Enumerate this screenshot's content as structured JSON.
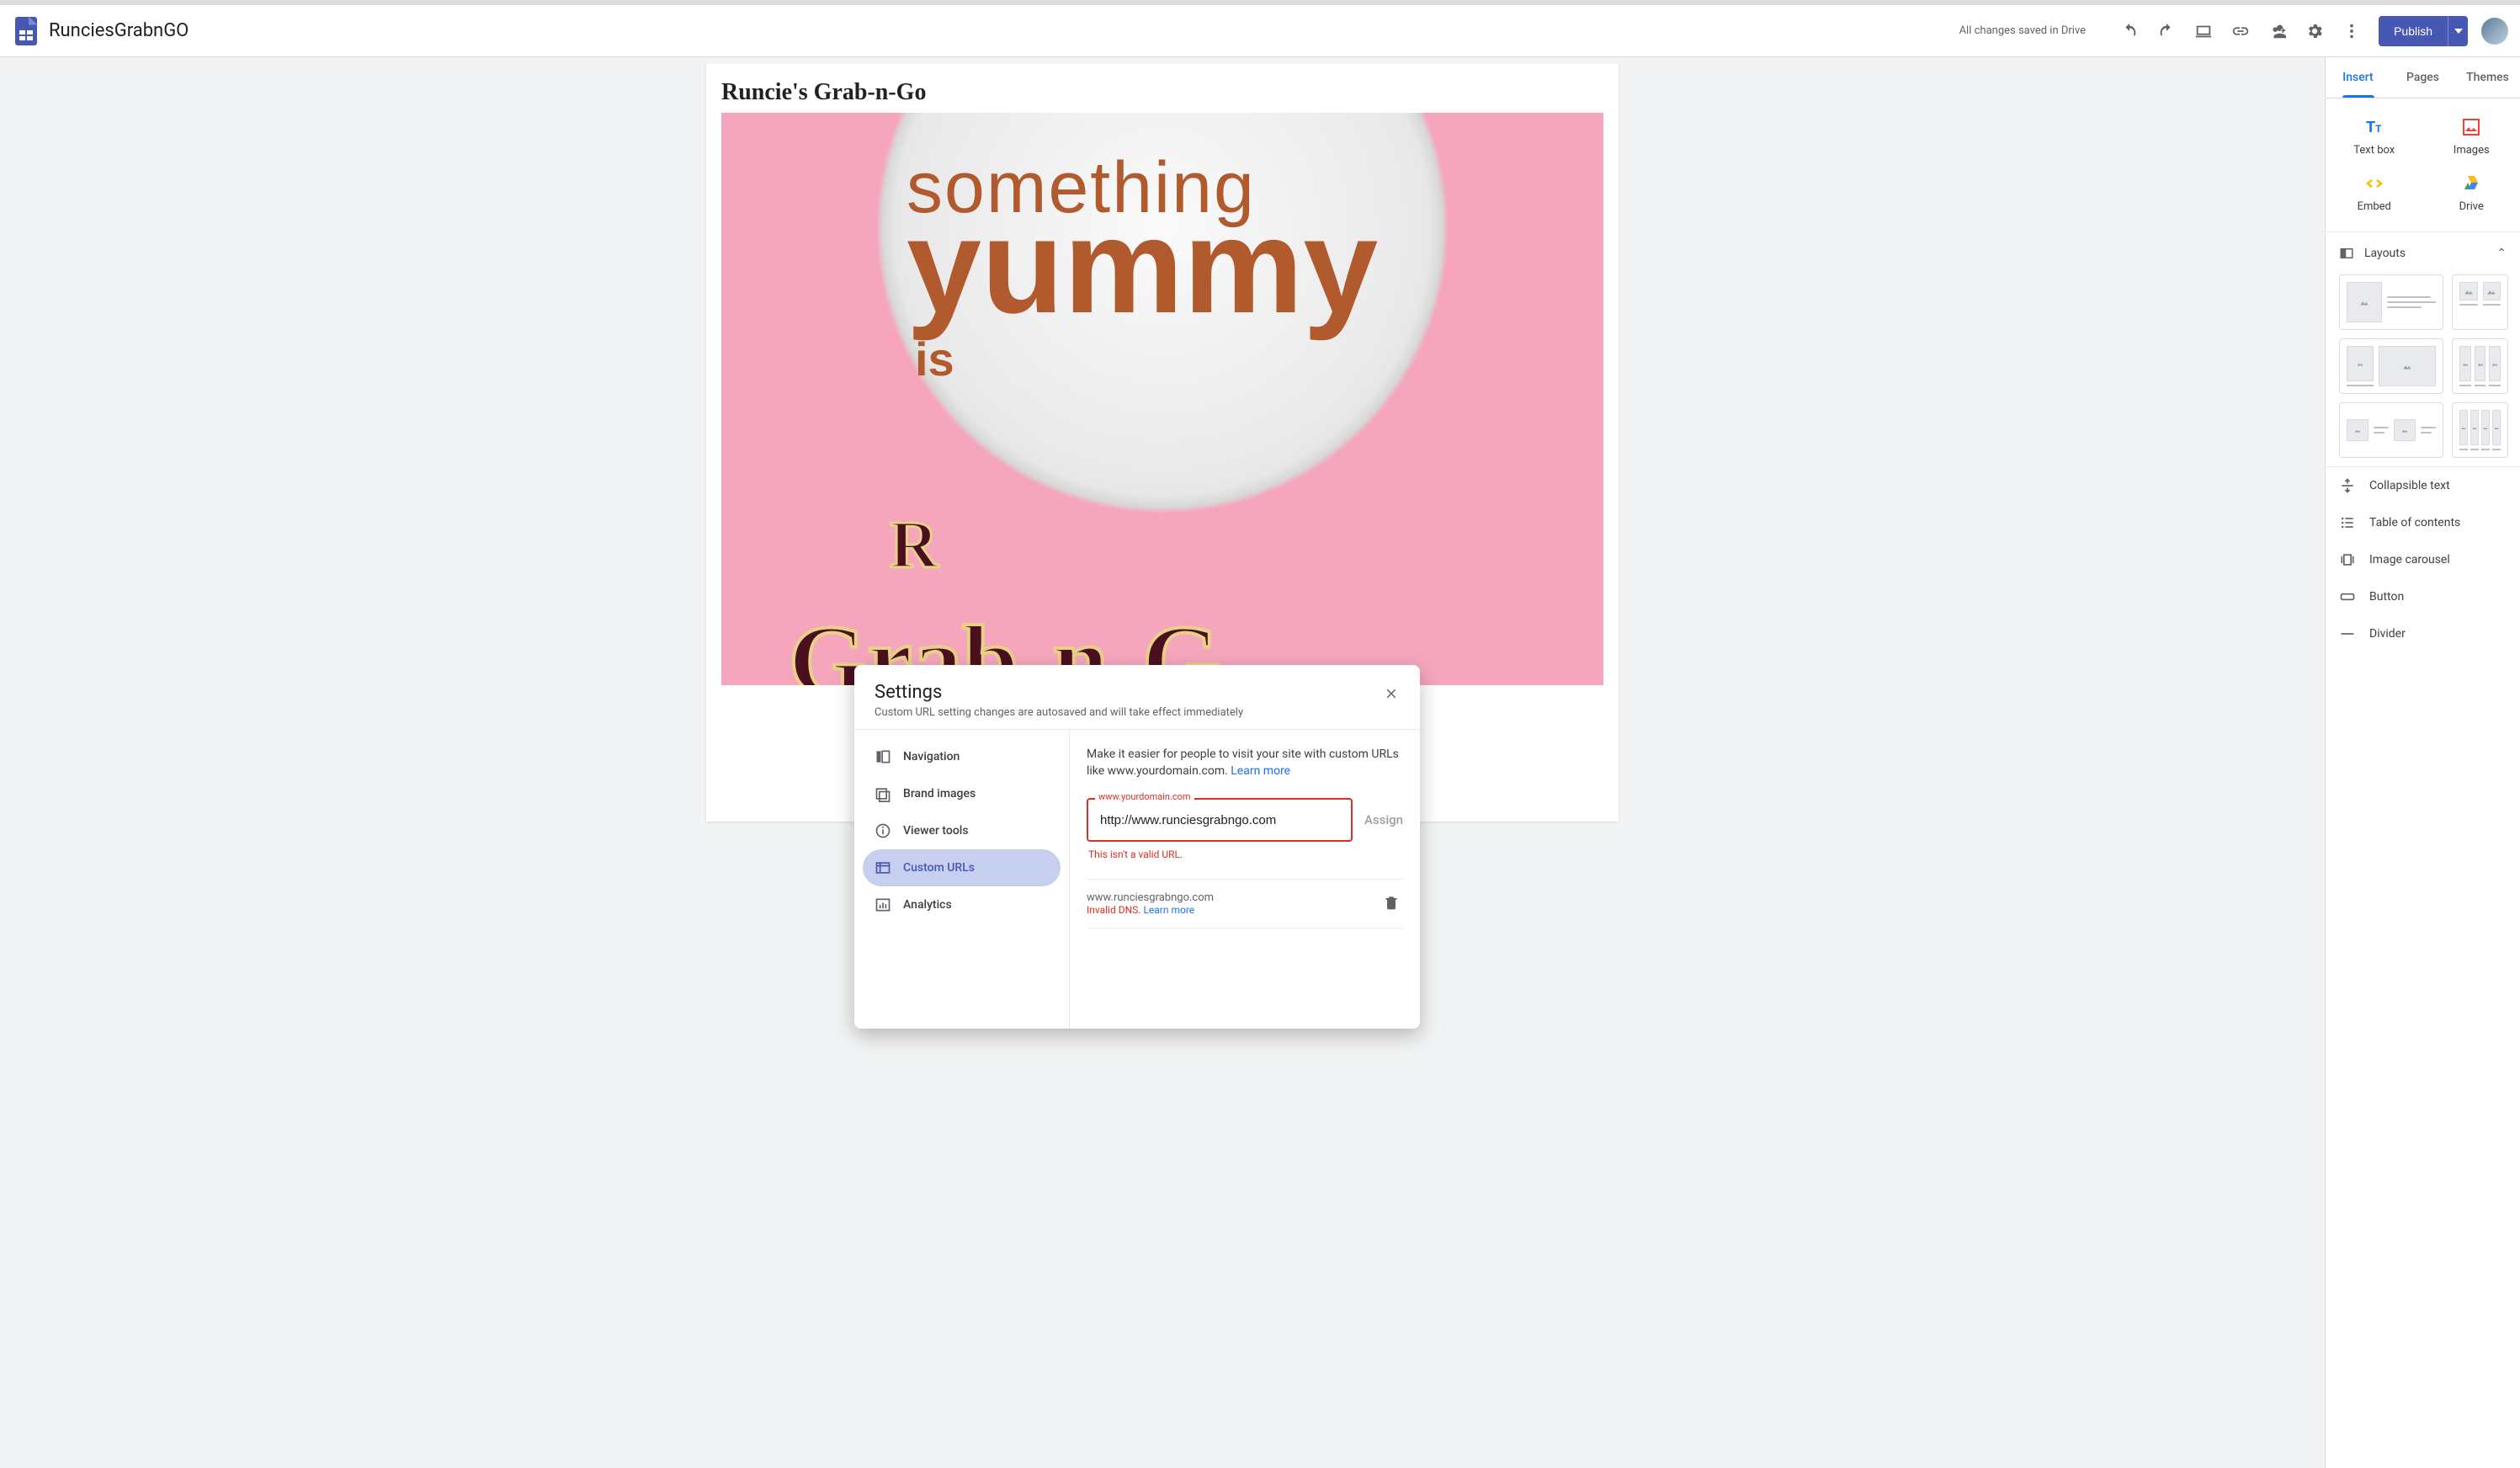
{
  "header": {
    "doc_title": "RunciesGrabnGO",
    "save_status": "All changes saved in Drive",
    "publish_label": "Publish"
  },
  "page": {
    "title": "Runcie's Grab-n-Go",
    "hero": {
      "line1": "something",
      "line2": "yummy",
      "line3": "is",
      "brand_top": "R",
      "brand_bottom": "Grab-n-G"
    }
  },
  "sidepanel": {
    "tabs": {
      "insert": "Insert",
      "pages": "Pages",
      "themes": "Themes"
    },
    "items": {
      "textbox": "Text box",
      "images": "Images",
      "embed": "Embed",
      "drive": "Drive"
    },
    "layouts_label": "Layouts",
    "list": {
      "collapsible": "Collapsible text",
      "toc": "Table of contents",
      "carousel": "Image carousel",
      "button": "Button",
      "divider": "Divider"
    }
  },
  "modal": {
    "title": "Settings",
    "subtitle": "Custom URL setting changes are autosaved and will take effect immediately",
    "nav": {
      "navigation": "Navigation",
      "brand": "Brand images",
      "viewer": "Viewer tools",
      "custom_urls": "Custom URLs",
      "analytics": "Analytics"
    },
    "content": {
      "description": "Make it easier for people to visit your site with custom URLs like www.yourdomain.com. ",
      "learn_more": "Learn more",
      "field_label": "www.yourdomain.com",
      "field_value": "http://www.runciesgrabngo.com",
      "assign": "Assign",
      "field_error": "This isn't a valid URL.",
      "existing_domain": "www.runciesgrabngo.com",
      "existing_error_prefix": "Invalid DNS. ",
      "existing_learn_more": "Learn more"
    }
  }
}
